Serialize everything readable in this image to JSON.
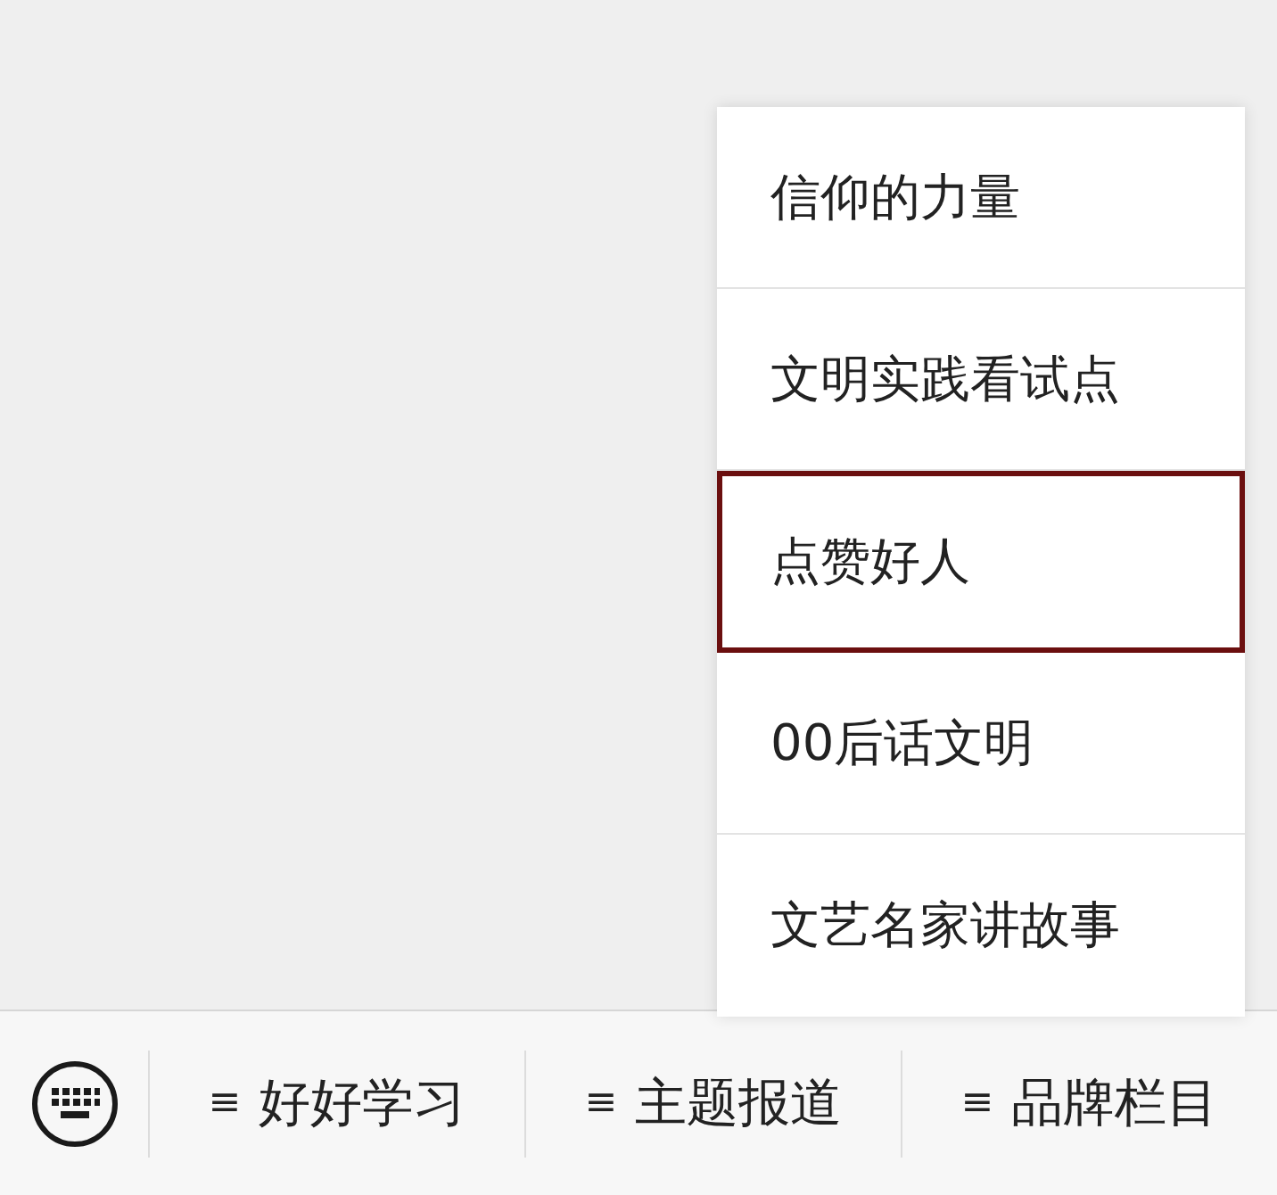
{
  "submenu": {
    "items": [
      {
        "label": "信仰的力量",
        "selected": false
      },
      {
        "label": "文明实践看试点",
        "selected": false
      },
      {
        "label": "点赞好人",
        "selected": true
      },
      {
        "label": "00后话文明",
        "selected": false
      },
      {
        "label": "文艺名家讲故事",
        "selected": false
      }
    ]
  },
  "menu_bar": {
    "tabs": [
      {
        "icon": "≡",
        "label": "好好学习"
      },
      {
        "icon": "≡",
        "label": "主题报道"
      },
      {
        "icon": "≡",
        "label": "品牌栏目"
      }
    ]
  }
}
